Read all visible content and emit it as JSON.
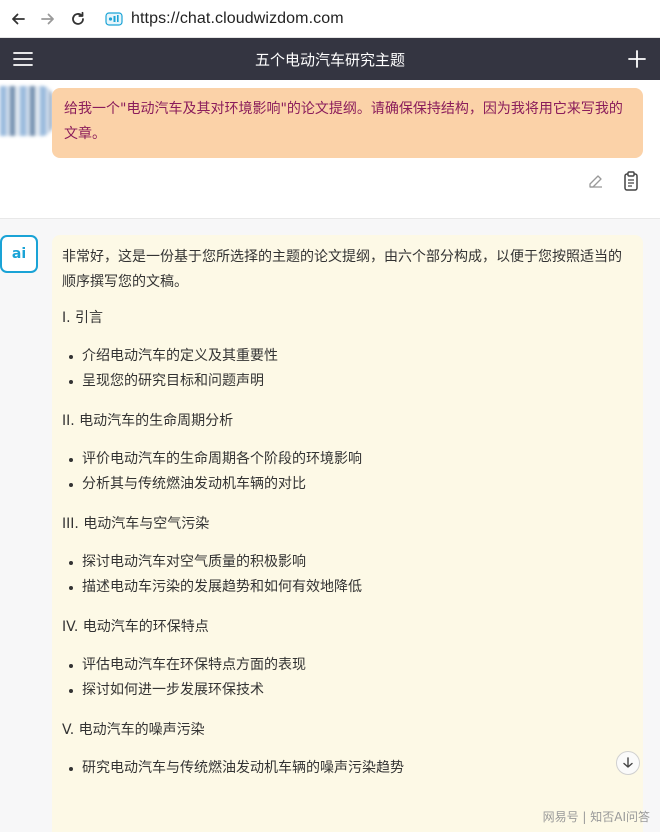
{
  "browser": {
    "url": "https://chat.cloudwizdom.com"
  },
  "header": {
    "title": "五个电动汽车研究主题"
  },
  "user_message": {
    "text": "给我一个\"电动汽车及其对环境影响\"的论文提纲。请确保保持结构，因为我将用它来写我的文章。"
  },
  "assistant": {
    "avatar_text": "ai",
    "intro": "非常好，这是一份基于您所选择的主题的论文提纲，由六个部分构成，以便于您按照适当的顺序撰写您的文稿。",
    "sections": [
      {
        "title": "I. 引言",
        "items": [
          "介绍电动汽车的定义及其重要性",
          "呈现您的研究目标和问题声明"
        ]
      },
      {
        "title": "II. 电动汽车的生命周期分析",
        "items": [
          "评价电动汽车的生命周期各个阶段的环境影响",
          "分析其与传统燃油发动机车辆的对比"
        ]
      },
      {
        "title": "III. 电动汽车与空气污染",
        "items": [
          "探讨电动汽车对空气质量的积极影响",
          "描述电动车污染的发展趋势和如何有效地降低"
        ]
      },
      {
        "title": "IV. 电动汽车的环保特点",
        "items": [
          "评估电动汽车在环保特点方面的表现",
          "探讨如何进一步发展环保技术"
        ]
      },
      {
        "title": "V. 电动汽车的噪声污染",
        "items": [
          "研究电动汽车与传统燃油发动机车辆的噪声污染趋势"
        ]
      }
    ]
  },
  "watermark": "网易号 | 知否AI问答",
  "icons": {
    "back": "arrow-left-icon",
    "forward": "arrow-right-icon",
    "reload": "reload-icon",
    "menu": "hamburger-menu-icon",
    "new_chat": "plus-icon",
    "edit": "edit-icon",
    "copy": "clipboard-icon",
    "scroll": "arrow-down-icon"
  },
  "colors": {
    "header_bg": "#343541",
    "user_bubble": "#fbd2a8",
    "user_text": "#8b1d5b",
    "ai_bubble": "#fdf9e6",
    "ai_accent": "#1aa3d6"
  }
}
